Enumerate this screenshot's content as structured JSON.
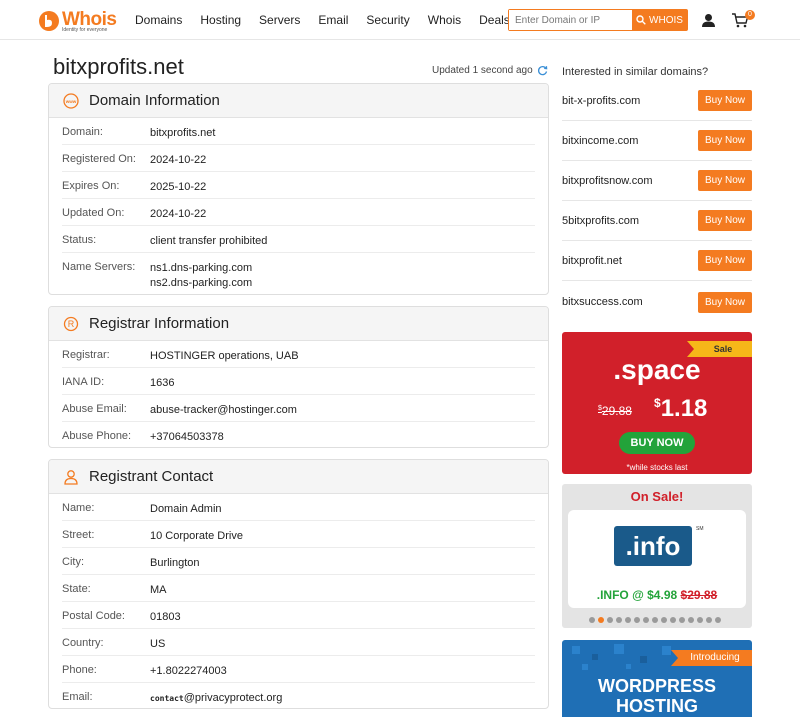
{
  "brand": {
    "name": "Whois",
    "tagline": "Identity for everyone"
  },
  "nav": [
    "Domains",
    "Hosting",
    "Servers",
    "Email",
    "Security",
    "Whois",
    "Deals"
  ],
  "search": {
    "placeholder": "Enter Domain or IP",
    "button": "WHOIS"
  },
  "cart_count": "0",
  "page": {
    "title": "bitxprofits.net",
    "updated": "Updated 1 second ago"
  },
  "domain_info": {
    "title": "Domain Information",
    "rows": [
      {
        "label": "Domain:",
        "value": "bitxprofits.net"
      },
      {
        "label": "Registered On:",
        "value": "2024-10-22"
      },
      {
        "label": "Expires On:",
        "value": "2025-10-22"
      },
      {
        "label": "Updated On:",
        "value": "2024-10-22"
      },
      {
        "label": "Status:",
        "value": "client transfer prohibited"
      },
      {
        "label": "Name Servers:",
        "value": "ns1.dns-parking.com",
        "value2": "ns2.dns-parking.com"
      }
    ]
  },
  "registrar_info": {
    "title": "Registrar Information",
    "rows": [
      {
        "label": "Registrar:",
        "value": "HOSTINGER operations, UAB"
      },
      {
        "label": "IANA ID:",
        "value": "1636"
      },
      {
        "label": "Abuse Email:",
        "value": "abuse-tracker@hostinger.com"
      },
      {
        "label": "Abuse Phone:",
        "value": "+37064503378"
      }
    ]
  },
  "registrant": {
    "title": "Registrant Contact",
    "rows": [
      {
        "label": "Name:",
        "value": "Domain Admin"
      },
      {
        "label": "Street:",
        "value": "10 Corporate Drive"
      },
      {
        "label": "City:",
        "value": "Burlington"
      },
      {
        "label": "State:",
        "value": "MA"
      },
      {
        "label": "Postal Code:",
        "value": "01803"
      },
      {
        "label": "Country:",
        "value": "US"
      },
      {
        "label": "Phone:",
        "value": "+1.8022274003"
      },
      {
        "label": "Email:",
        "value_prefix": "contact",
        "value": "@privacyprotect.org"
      }
    ]
  },
  "similar": {
    "title": "Interested in similar domains?",
    "button": "Buy Now",
    "domains": [
      "bit-x-profits.com",
      "bitxincome.com",
      "bitxprofitsnow.com",
      "5bitxprofits.com",
      "bitxprofit.net",
      "bitxsuccess.com"
    ]
  },
  "promo_space": {
    "ribbon": "Sale",
    "ext": ".space",
    "old_price": "29.88",
    "new_price": "1.18",
    "currency": "$",
    "button": "BUY NOW",
    "note": "*while stocks last"
  },
  "promo_info": {
    "title": "On Sale!",
    "logo": ".info",
    "sm": "SM",
    "price": ".INFO @ $4.98",
    "old_price": "$29.88"
  },
  "promo_wp": {
    "ribbon": "Introducing",
    "line1": "WORDPRESS",
    "line2": "HOSTING"
  },
  "colors": {
    "accent": "#f47b20",
    "sale_red": "#d1202a",
    "green": "#23a33a",
    "info_blue": "#1a5a8a"
  }
}
